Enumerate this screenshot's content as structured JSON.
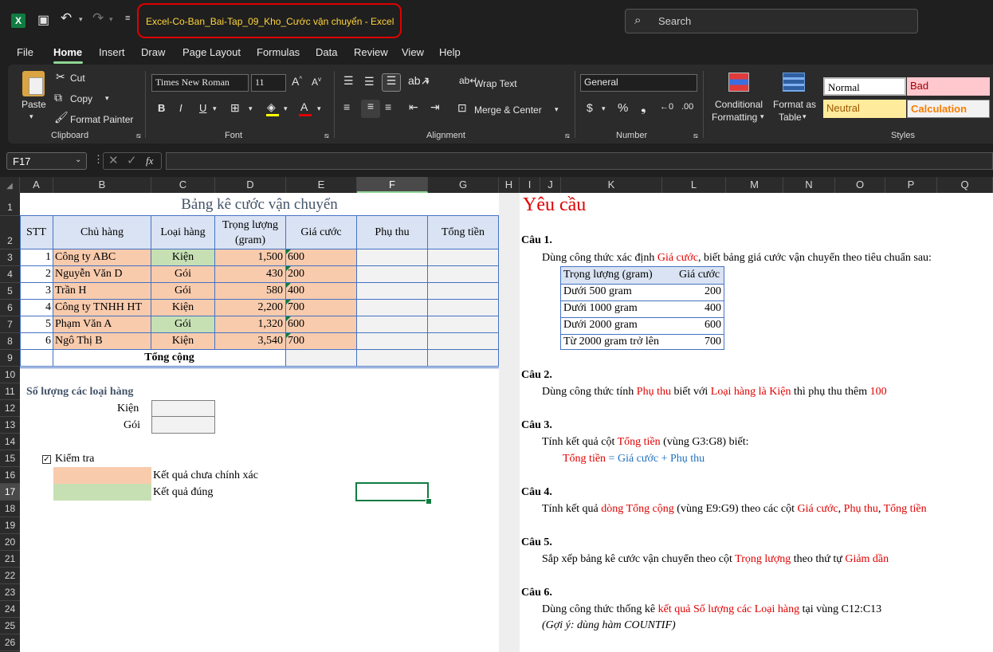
{
  "app": {
    "title": "Excel-Co-Ban_Bai-Tap_09_Kho_Cước vận chuyển  -  Excel",
    "search_placeholder": "Search"
  },
  "menu": [
    "File",
    "Home",
    "Insert",
    "Draw",
    "Page Layout",
    "Formulas",
    "Data",
    "Review",
    "View",
    "Help"
  ],
  "ribbon": {
    "clipboard": {
      "paste": "Paste",
      "cut": "Cut",
      "copy": "Copy",
      "format_painter": "Format Painter",
      "label": "Clipboard"
    },
    "font": {
      "name": "Times New Roman",
      "size": "11",
      "label": "Font"
    },
    "alignment": {
      "wrap": "Wrap Text",
      "merge": "Merge & Center",
      "label": "Alignment"
    },
    "number": {
      "format": "General",
      "label": "Number"
    },
    "styles": {
      "conditional": "Conditional",
      "conditional2": "Formatting",
      "format_table": "Format as",
      "format_table2": "Table",
      "normal": "Normal",
      "bad": "Bad",
      "neutral": "Neutral",
      "calculation": "Calculation",
      "label": "Styles"
    }
  },
  "formula_bar": {
    "name_box": "F17",
    "fx": "fx",
    "value": ""
  },
  "columns": [
    "A",
    "B",
    "C",
    "D",
    "E",
    "F",
    "G",
    "H",
    "I",
    "J",
    "K",
    "L",
    "M",
    "N",
    "O",
    "P",
    "Q"
  ],
  "rows": [
    "1",
    "2",
    "3",
    "4",
    "5",
    "6",
    "7",
    "8",
    "9",
    "10",
    "11",
    "12",
    "13",
    "14",
    "15",
    "16",
    "17",
    "18",
    "19",
    "20",
    "21",
    "22",
    "23",
    "24",
    "25",
    "26"
  ],
  "table": {
    "title": "Bảng kê cước vận chuyển",
    "headers": {
      "stt": "STT",
      "chu_hang": "Chủ hàng",
      "loai_hang": "Loại hàng",
      "trong_luong": "Trọng lượng",
      "trong_luong2": "(gram)",
      "gia_cuoc": "Giá cước",
      "phu_thu": "Phụ thu",
      "tong_tien": "Tổng tiền"
    },
    "rows": [
      {
        "stt": "1",
        "chu": "Công ty ABC",
        "loai": "Kiện",
        "tl": "1,500",
        "gia": "600"
      },
      {
        "stt": "2",
        "chu": "Nguyễn Văn D",
        "loai": "Gói",
        "tl": "430",
        "gia": "200"
      },
      {
        "stt": "3",
        "chu": "Trần H",
        "loai": "Gói",
        "tl": "580",
        "gia": "400"
      },
      {
        "stt": "4",
        "chu": "Công ty TNHH HT",
        "loai": "Kiện",
        "tl": "2,200",
        "gia": "700"
      },
      {
        "stt": "5",
        "chu": "Phạm Văn A",
        "loai": "Gói",
        "tl": "1,320",
        "gia": "600"
      },
      {
        "stt": "6",
        "chu": "Ngô Thị B",
        "loai": "Kiện",
        "tl": "3,540",
        "gia": "700"
      }
    ],
    "total_label": "Tổng cộng"
  },
  "counts": {
    "title": "Số lượng các loại hàng",
    "kien": "Kiện",
    "goi": "Gói"
  },
  "check": {
    "label": "Kiểm tra",
    "wrong": "Kết quả chưa chính xác",
    "right": "Kết quả đúng"
  },
  "colors": {
    "peach": "#f8cbad",
    "green": "#c6e0b4",
    "red": "#e00000",
    "blue": "#1f6fbf",
    "header": "#dae3f3",
    "excel_green": "#107c41"
  },
  "req": {
    "title": "Yêu cầu",
    "q1": {
      "label": "Câu 1.",
      "a": "Dùng công thức xác định ",
      "b": "Giá cước",
      "c": ", biết bảng giá cước vận chuyển theo tiêu chuẩn sau:"
    },
    "price_table": {
      "h1": "Trọng lượng (gram)",
      "h2": "Giá cước",
      "rows": [
        {
          "a": "Dưới 500 gram",
          "b": "200"
        },
        {
          "a": "Dưới 1000 gram",
          "b": "400"
        },
        {
          "a": "Dưới 2000 gram",
          "b": "600"
        },
        {
          "a": "Từ 2000 gram trở lên",
          "b": "700"
        }
      ]
    },
    "q2": {
      "label": "Câu 2.",
      "a": "Dùng công thức tính ",
      "b": "Phụ thu",
      "c": " biết với ",
      "d": "Loại hàng là Kiện",
      "e": " thì phụ thu thêm ",
      "f": "100"
    },
    "q3": {
      "label": "Câu 3.",
      "a": "Tính kết quả cột ",
      "b": "Tổng tiền",
      "c": " (vùng G3:G8) biết:",
      "f1": "Tổng tiền",
      "f2": " = ",
      "f3": "Giá cước",
      "f4": " + ",
      "f5": "Phụ thu"
    },
    "q4": {
      "label": "Câu 4.",
      "a": "Tính kết quả ",
      "b": "dòng Tổng cộng",
      "c": " (vùng E9:G9) theo các cột ",
      "d": "Giá cước",
      "e": ", ",
      "f": "Phụ thu",
      "g": ", ",
      "h": "Tổng tiền"
    },
    "q5": {
      "label": "Câu 5.",
      "a": "Sắp xếp bảng kê cước vận chuyển theo cột ",
      "b": "Trọng lượng",
      "c": " theo thứ tự ",
      "d": "Giảm dần"
    },
    "q6": {
      "label": "Câu 6.",
      "a": "Dùng công thức thống kê ",
      "b": "kết quả Số lượng các Loại hàng",
      "c": " tại vùng C12:C13",
      "hint": "(Gợi ý: dùng hàm COUNTIF)"
    }
  }
}
